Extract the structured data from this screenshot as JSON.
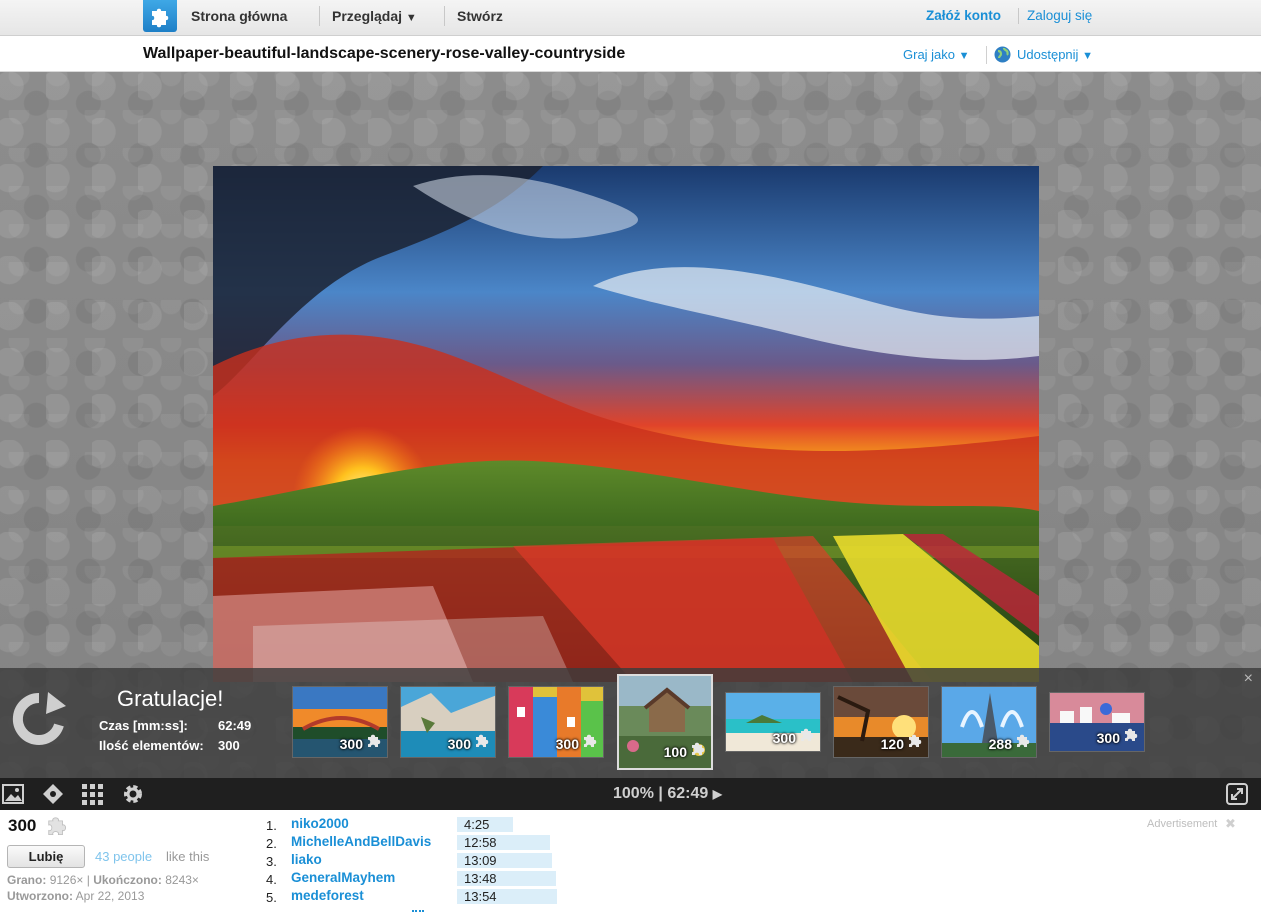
{
  "nav": {
    "home": "Strona główna",
    "browse": "Przeglądaj",
    "browse_arrow": "▼",
    "create": "Stwórz",
    "signup": "Załóż konto",
    "login": "Zaloguj się"
  },
  "title": "Wallpaper-beautiful-landscape-scenery-rose-valley-countryside",
  "header_actions": {
    "play_as": "Graj jako",
    "share": "Udostępnij",
    "arrow": "▼"
  },
  "congrats": {
    "heading": "Gratulacje!",
    "time_label": "Czas [mm:ss]:",
    "time_value": "62:49",
    "pieces_label": "Ilość elementów:",
    "pieces_value": "300",
    "close": "×"
  },
  "thumbnails": [
    {
      "count": "300",
      "scene": "bridge-sunset"
    },
    {
      "count": "300",
      "scene": "coastal-rocks"
    },
    {
      "count": "300",
      "scene": "colorful-houses"
    },
    {
      "count": "100",
      "scene": "cottage-garden"
    },
    {
      "count": "300",
      "scene": "tropical-beach"
    },
    {
      "count": "120",
      "scene": "sunset-tree"
    },
    {
      "count": "288",
      "scene": "eiffel-fountain"
    },
    {
      "count": "300",
      "scene": "santorini"
    }
  ],
  "toolbar": {
    "status_zoom": "100%",
    "status_sep": "|",
    "status_time": "62:49",
    "play_icon": "▶"
  },
  "info": {
    "piece_count": "300",
    "like_button": "Lubię",
    "likes_link": "43 people",
    "likes_suffix": "like this",
    "played_label": "Grano:",
    "played_value": "9126×",
    "stats_sep": "|",
    "completed_label": "Ukończono:",
    "completed_value": "8243×",
    "created_label": "Utworzono:",
    "created_value": "Apr 22, 2013"
  },
  "leaderboard": [
    {
      "rank": "1.",
      "name": "niko2000",
      "time": "4:25",
      "bar": 0.55
    },
    {
      "rank": "2.",
      "name": "MichelleAndBellDavis",
      "time": "12:58",
      "bar": 0.9
    },
    {
      "rank": "3.",
      "name": "liako",
      "time": "13:09",
      "bar": 0.93
    },
    {
      "rank": "4.",
      "name": "GeneralMayhem",
      "time": "13:48",
      "bar": 0.98
    },
    {
      "rank": "5.",
      "name": "medeforest",
      "time": "13:54",
      "bar": 0.99
    }
  ],
  "ad_label": "Advertisement",
  "ad_close": "✖",
  "colors": {
    "accent": "#1a8fd6",
    "toolbar": "#1f1f1f",
    "stage": "#8a8a8a"
  }
}
